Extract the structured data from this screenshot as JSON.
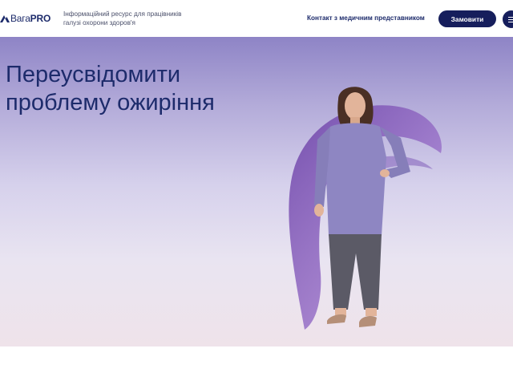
{
  "header": {
    "logo": {
      "word": "Вага",
      "suffix": "PRO"
    },
    "tagline": "Інформаційний ресурс для працівників галузі охорони здоров'я",
    "contact_link": "Контакт з медичним представником",
    "order_button": "Замовити",
    "menu_icon": "hamburger-menu-icon"
  },
  "hero": {
    "headline": "Переусвідомити проблему ожиріння",
    "image": "woman-standing-photo"
  },
  "colors": {
    "brand_navy": "#161e5c",
    "text_navy": "#1d2b6b",
    "hero_top": "#8e84c6",
    "hero_bottom": "#efe3ea"
  }
}
